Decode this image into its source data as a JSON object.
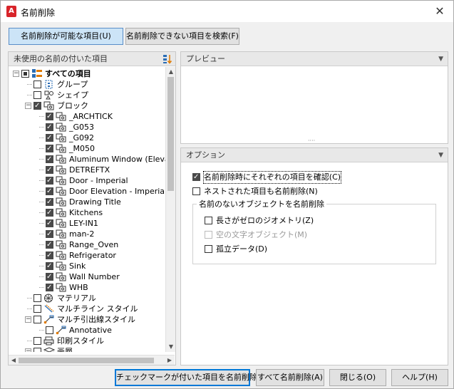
{
  "window": {
    "title": "名前削除",
    "app_icon_letter": "A",
    "close_glyph": "✕"
  },
  "mode_buttons": {
    "purgeable": "名前削除が可能な項目(U)",
    "find_unpurgeable": "名前削除できない項目を検索(F)"
  },
  "left_panel": {
    "header": "未使用の名前の付いた項目"
  },
  "tree": [
    {
      "label": "すべての項目",
      "bold": true,
      "icon": "all-items-icon",
      "state": "partial",
      "expander": "−"
    },
    {
      "label": "グループ",
      "icon": "group-icon",
      "state": "unchecked"
    },
    {
      "label": "シェイプ",
      "icon": "shape-icon",
      "state": "unchecked"
    },
    {
      "label": "ブロック",
      "icon": "block-icon",
      "state": "checked",
      "expander": "−"
    },
    {
      "label": "_ARCHTICK",
      "icon": "block-icon",
      "state": "checked"
    },
    {
      "label": "_G053",
      "icon": "block-icon",
      "state": "checked"
    },
    {
      "label": "_G092",
      "icon": "block-icon",
      "state": "checked"
    },
    {
      "label": "_M050",
      "icon": "block-icon",
      "state": "checked"
    },
    {
      "label": "Aluminum Window (Elevatio",
      "icon": "block-icon",
      "state": "checked"
    },
    {
      "label": "DETREFTX",
      "icon": "block-icon",
      "state": "checked"
    },
    {
      "label": "Door - Imperial",
      "icon": "block-icon",
      "state": "checked"
    },
    {
      "label": "Door Elevation - Imperial",
      "icon": "block-icon",
      "state": "checked"
    },
    {
      "label": "Drawing Title",
      "icon": "block-icon",
      "state": "checked"
    },
    {
      "label": "Kitchens",
      "icon": "block-icon",
      "state": "checked"
    },
    {
      "label": "LEY-IN1",
      "icon": "block-icon",
      "state": "checked"
    },
    {
      "label": "man-2",
      "icon": "block-icon",
      "state": "checked"
    },
    {
      "label": "Range_Oven",
      "icon": "block-icon",
      "state": "checked"
    },
    {
      "label": "Refrigerator",
      "icon": "block-icon",
      "state": "checked"
    },
    {
      "label": "Sink",
      "icon": "block-icon",
      "state": "checked"
    },
    {
      "label": "Wall Number",
      "icon": "block-icon",
      "state": "checked"
    },
    {
      "label": "WHB",
      "icon": "block-icon",
      "state": "checked"
    },
    {
      "label": "マテリアル",
      "icon": "material-icon",
      "state": "unchecked"
    },
    {
      "label": "マルチライン スタイル",
      "icon": "multiline-icon",
      "state": "unchecked"
    },
    {
      "label": "マルチ引出線スタイル",
      "icon": "mleader-icon",
      "state": "unchecked",
      "expander": "−"
    },
    {
      "label": "Annotative",
      "icon": "mleader-icon",
      "state": "unchecked"
    },
    {
      "label": "印刷スタイル",
      "icon": "plot-style-icon",
      "state": "unchecked"
    },
    {
      "label": "画層",
      "icon": "layer-icon",
      "state": "unchecked",
      "expander": "−"
    }
  ],
  "preview_panel": {
    "header": "プレビュー"
  },
  "options_panel": {
    "header": "オプション",
    "confirm_each": {
      "label": "名前削除時にそれぞれの項目を確認(C)",
      "checked": true
    },
    "purge_nested": {
      "label": "ネストされた項目も名前削除(N)",
      "checked": false
    },
    "unnamed_group": {
      "legend": "名前のないオブジェクトを名前削除",
      "zero_length": {
        "label": "長さがゼロのジオメトリ(Z)",
        "checked": false
      },
      "empty_text": {
        "label": "空の文字オブジェクト(M)",
        "checked": false
      },
      "orphaned_data": {
        "label": "孤立データ(D)",
        "checked": false
      }
    }
  },
  "footer_buttons": {
    "purge_checked": "チェックマークが付いた項目を名前削除(P)",
    "purge_all": "すべて名前削除(A)",
    "close": "閉じる(O)",
    "help": "ヘルプ(H)"
  }
}
